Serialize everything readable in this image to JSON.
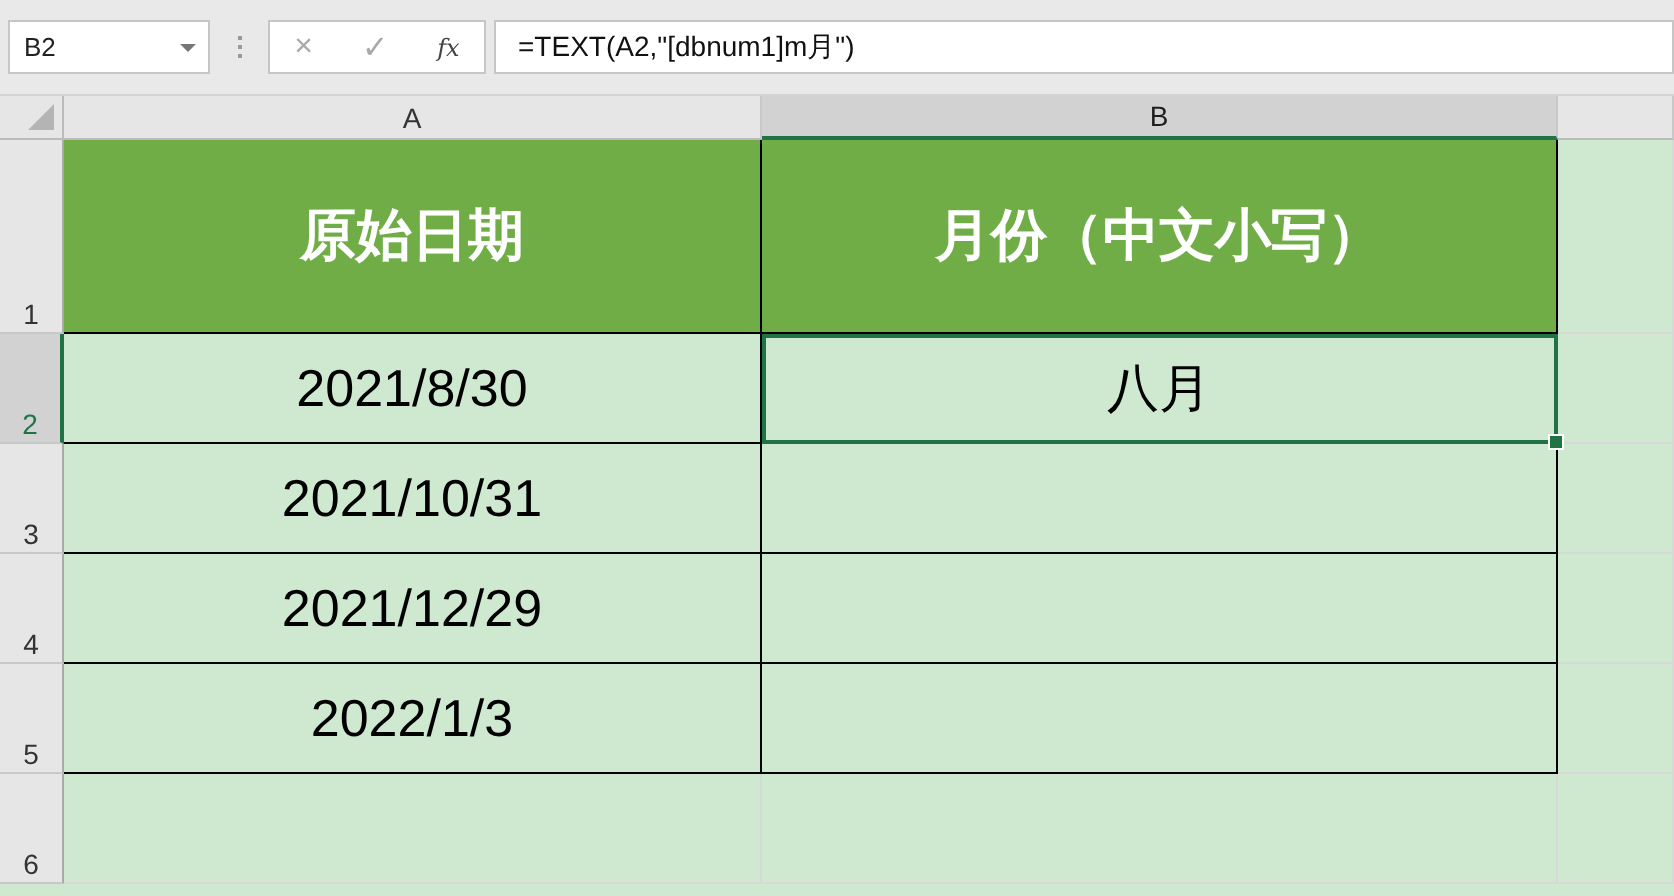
{
  "name_box": {
    "value": "B2"
  },
  "formula_bar": {
    "cancel": "×",
    "enter": "✓",
    "function": "fx",
    "formula": "=TEXT(A2,\"[dbnum1]m月\")"
  },
  "columns": [
    {
      "label": "A",
      "selected": false
    },
    {
      "label": "B",
      "selected": true
    }
  ],
  "rows": [
    {
      "number": "1",
      "selected": false,
      "kind": "header",
      "cells": [
        "原始日期",
        "月份（中文小写）"
      ]
    },
    {
      "number": "2",
      "selected": true,
      "kind": "data",
      "cells": [
        "2021/8/30",
        "八月"
      ]
    },
    {
      "number": "3",
      "selected": false,
      "kind": "data",
      "cells": [
        "2021/10/31"
      ]
    },
    {
      "number": "4",
      "selected": false,
      "kind": "data",
      "cells": [
        "2021/12/29"
      ]
    },
    {
      "number": "5",
      "selected": false,
      "kind": "data",
      "cells": [
        "2022/1/3"
      ]
    },
    {
      "number": "6",
      "selected": false,
      "kind": "empty",
      "cells": []
    }
  ]
}
